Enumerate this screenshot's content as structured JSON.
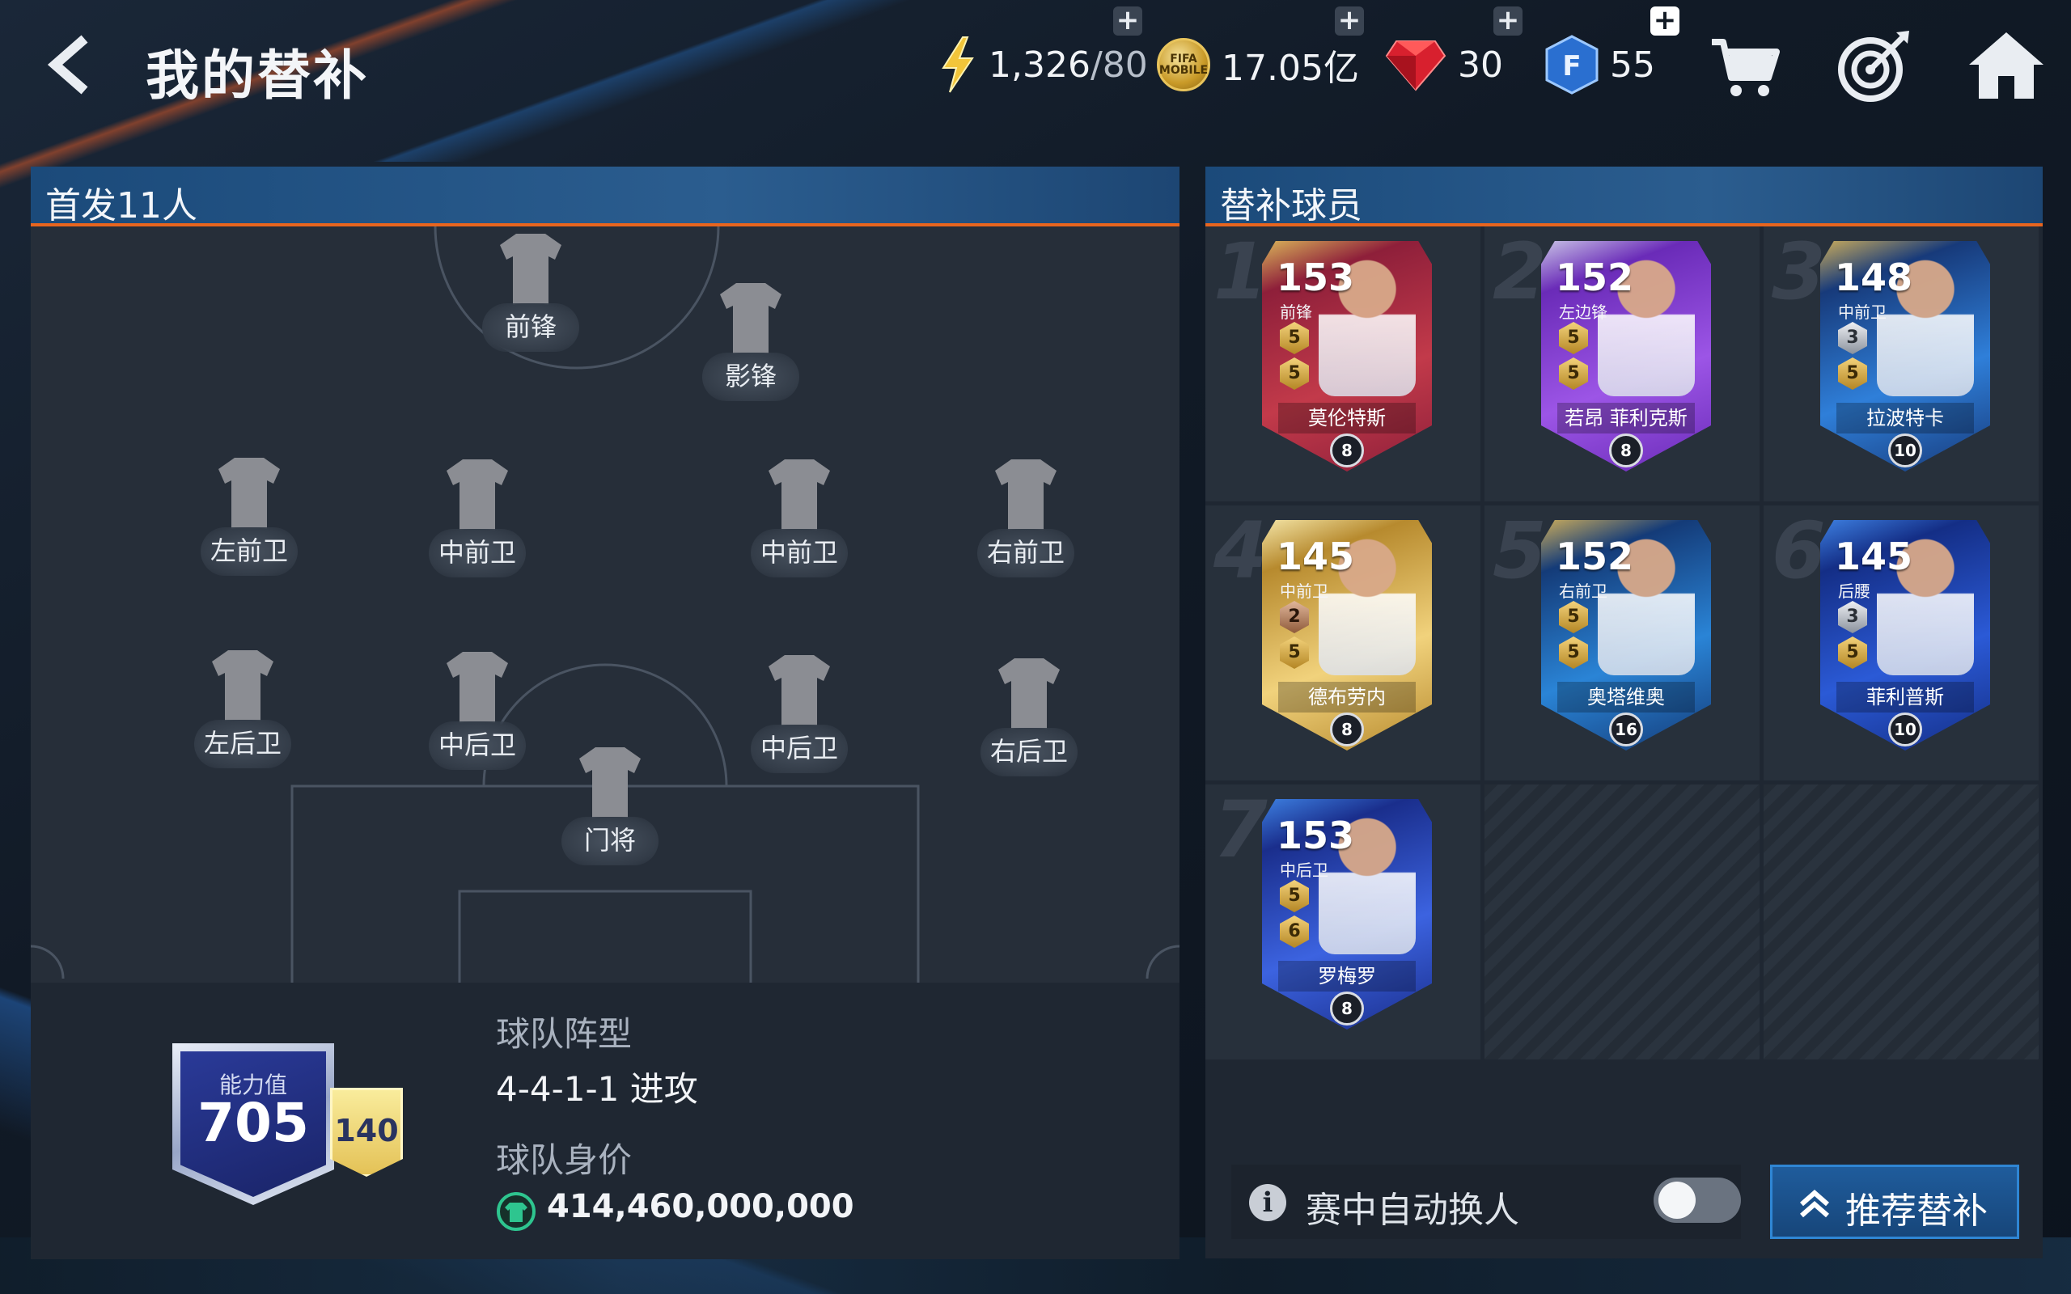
{
  "header": {
    "title": "我的替补",
    "resources": {
      "energy": {
        "value": "1,326",
        "max": "/80"
      },
      "coins": {
        "value": "17.05亿",
        "icon_text": "FIFA MOBILE"
      },
      "gems": {
        "value": "30"
      },
      "fc_points": {
        "value": "55",
        "icon_text": "F"
      }
    },
    "icons": [
      "back-icon",
      "lightning-icon",
      "coin-icon",
      "gem-icon",
      "fc-points-icon",
      "cart-icon",
      "target-icon",
      "home-icon"
    ]
  },
  "starting": {
    "title": "首发11人",
    "positions": [
      {
        "label": "前锋"
      },
      {
        "label": "影锋"
      },
      {
        "label": "左前卫"
      },
      {
        "label": "中前卫"
      },
      {
        "label": "中前卫"
      },
      {
        "label": "右前卫"
      },
      {
        "label": "左后卫"
      },
      {
        "label": "中后卫"
      },
      {
        "label": "中后卫"
      },
      {
        "label": "右后卫"
      },
      {
        "label": "门将"
      }
    ]
  },
  "team": {
    "power_label": "能力值",
    "power_value": "705",
    "power_side": "140",
    "formation_label": "球队阵型",
    "formation_value": "4-4-1-1 进攻",
    "value_label": "球队身价",
    "value": "414,460,000,000"
  },
  "subs": {
    "title": "替补球员",
    "players": [
      {
        "slot": "1",
        "ovr": "153",
        "pos": "前锋",
        "chips": [
          "5",
          "5"
        ],
        "name": "莫伦特斯",
        "level": "8",
        "theme": "#8e1f3a",
        "theme2": "#c23a4a",
        "frame": "#d9b45a"
      },
      {
        "slot": "2",
        "ovr": "152",
        "pos": "左边锋",
        "chips": [
          "5",
          "5"
        ],
        "name": "若昂 菲利克斯",
        "level": "8",
        "theme": "#6a2bb8",
        "theme2": "#9c55e6",
        "frame": "#c8c2e6"
      },
      {
        "slot": "3",
        "ovr": "148",
        "pos": "中前卫",
        "chips": [
          "3",
          "5"
        ],
        "name": "拉波特卡",
        "level": "10",
        "theme": "#173a7a",
        "theme2": "#2f7fd9",
        "frame": "#c9ab5c"
      },
      {
        "slot": "4",
        "ovr": "145",
        "pos": "中前卫",
        "chips": [
          "2",
          "5"
        ],
        "name": "德布劳内",
        "level": "8",
        "theme": "#b78a2e",
        "theme2": "#f1d27c",
        "frame": "#f3e4a6"
      },
      {
        "slot": "5",
        "ovr": "152",
        "pos": "右前卫",
        "chips": [
          "5",
          "5"
        ],
        "name": "奥塔维奥",
        "level": "16",
        "theme": "#143b78",
        "theme2": "#2a84d6",
        "frame": "#c9ab5c"
      },
      {
        "slot": "6",
        "ovr": "145",
        "pos": "后腰",
        "chips": [
          "3",
          "5"
        ],
        "name": "菲利普斯",
        "level": "10",
        "theme": "#142e86",
        "theme2": "#2b5ad6",
        "frame": "#3d7fe0"
      },
      {
        "slot": "7",
        "ovr": "153",
        "pos": "中后卫",
        "chips": [
          "5",
          "6"
        ],
        "name": "罗梅罗",
        "level": "8",
        "theme": "#1a2e8c",
        "theme2": "#3c63e0",
        "frame": "#3d7fe0"
      }
    ],
    "empty_slots": 2
  },
  "auto_sub": {
    "label": "赛中自动换人",
    "enabled": false
  },
  "recommend_button": {
    "label": "推荐替补"
  }
}
